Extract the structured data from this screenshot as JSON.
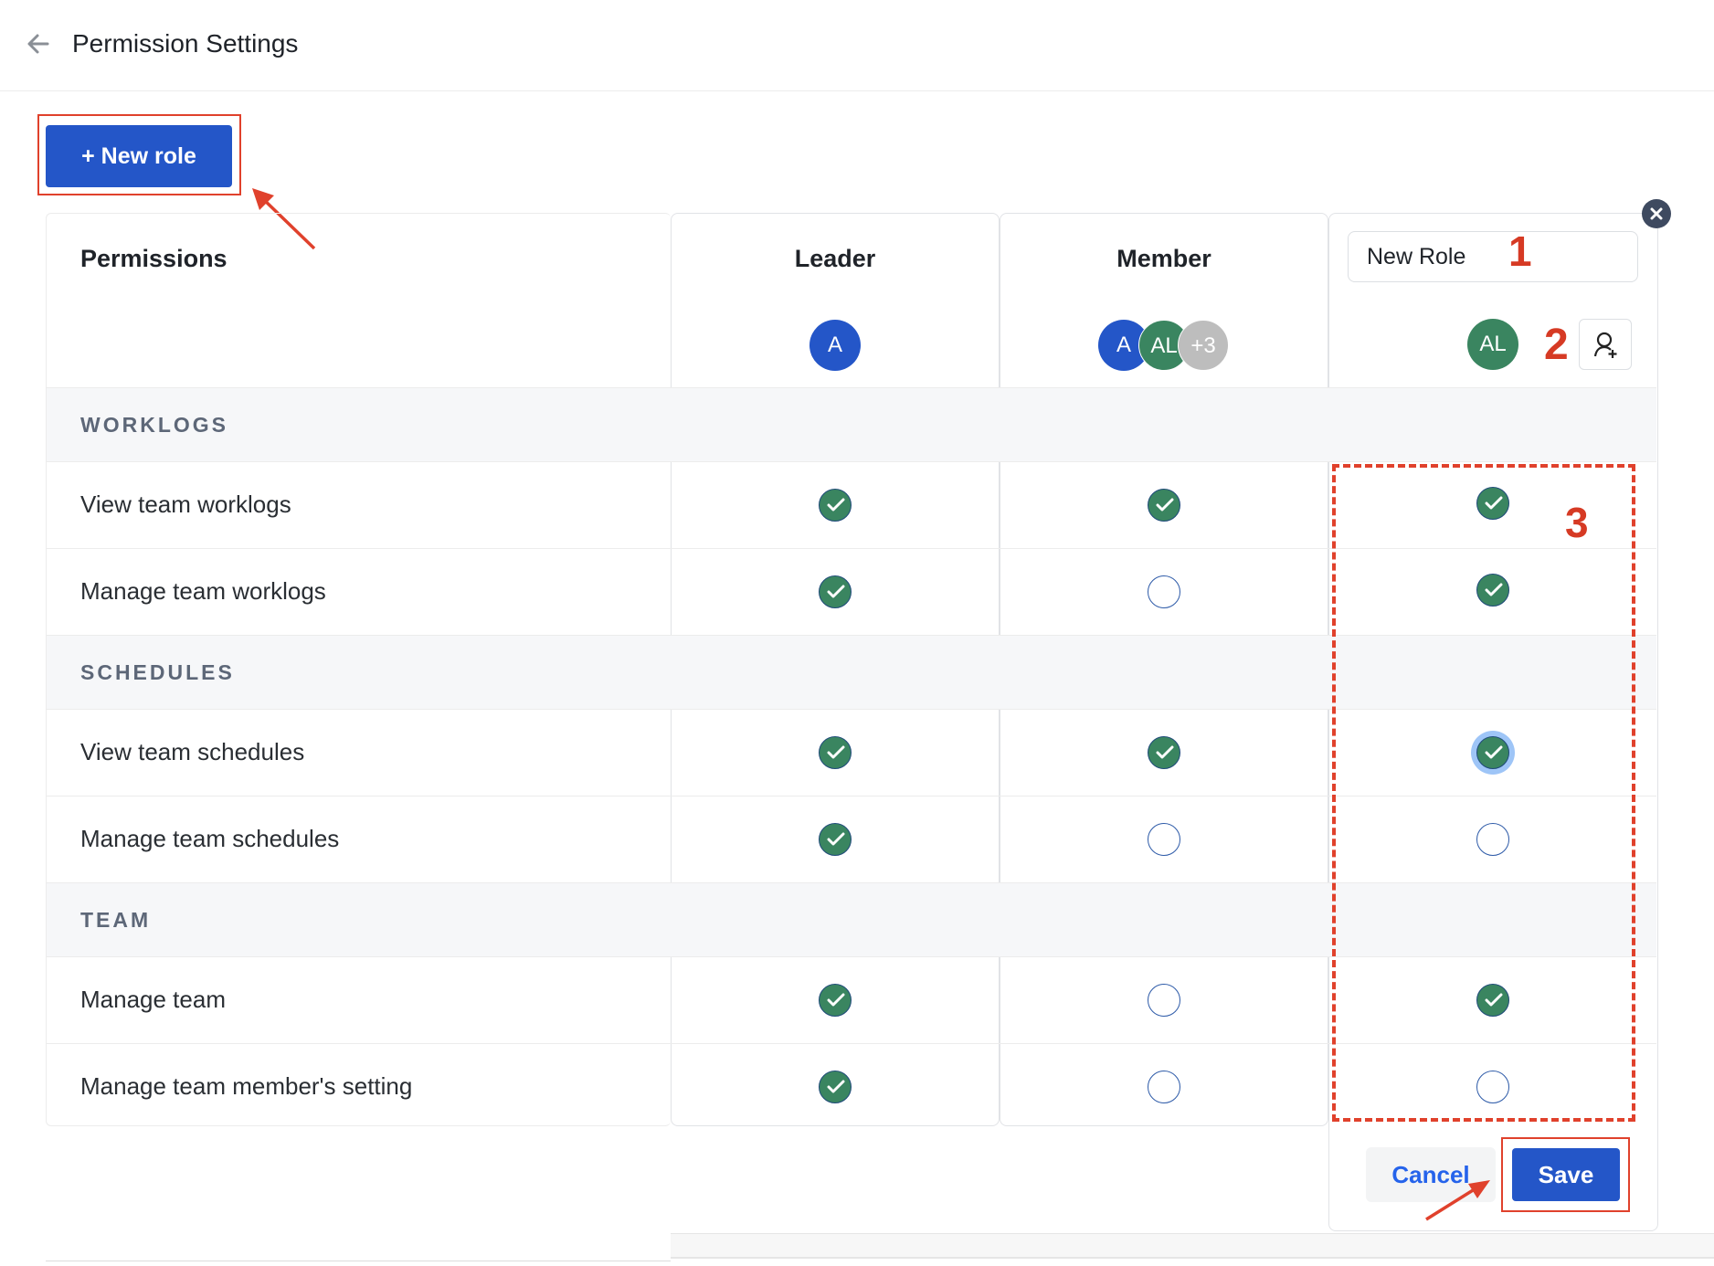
{
  "header": {
    "title": "Permission Settings",
    "back_icon": "arrow-left-icon"
  },
  "toolbar": {
    "new_role_label": "+ New role"
  },
  "table": {
    "permissions_header": "Permissions",
    "roles": [
      {
        "name": "Leader",
        "avatars": [
          "A"
        ]
      },
      {
        "name": "Member",
        "avatars": [
          "A",
          "AL",
          "+3"
        ]
      }
    ],
    "new_role": {
      "name_value": "New Role",
      "avatars": [
        "AL"
      ],
      "add_member_icon": "user-plus-icon",
      "close_icon": "close-icon"
    },
    "sections": [
      {
        "label": "WORKLOGS",
        "rows": [
          {
            "label": "View team worklogs",
            "leader": true,
            "member": true,
            "new": true
          },
          {
            "label": "Manage team worklogs",
            "leader": true,
            "member": false,
            "new": true
          }
        ]
      },
      {
        "label": "SCHEDULES",
        "rows": [
          {
            "label": "View team schedules",
            "leader": true,
            "member": true,
            "new": true,
            "focused": true
          },
          {
            "label": "Manage team schedules",
            "leader": true,
            "member": false,
            "new": false
          }
        ]
      },
      {
        "label": "TEAM",
        "rows": [
          {
            "label": "Manage team",
            "leader": true,
            "member": false,
            "new": true
          },
          {
            "label": "Manage team member's setting",
            "leader": true,
            "member": false,
            "new": false
          }
        ]
      }
    ]
  },
  "actions": {
    "cancel_label": "Cancel",
    "save_label": "Save"
  },
  "annotations": {
    "step1": "1",
    "step2": "2",
    "step3": "3"
  },
  "colors": {
    "primary": "#2456c8",
    "check_on": "#3a8560",
    "annotation": "#e0412c",
    "section_text": "#5d6778"
  }
}
